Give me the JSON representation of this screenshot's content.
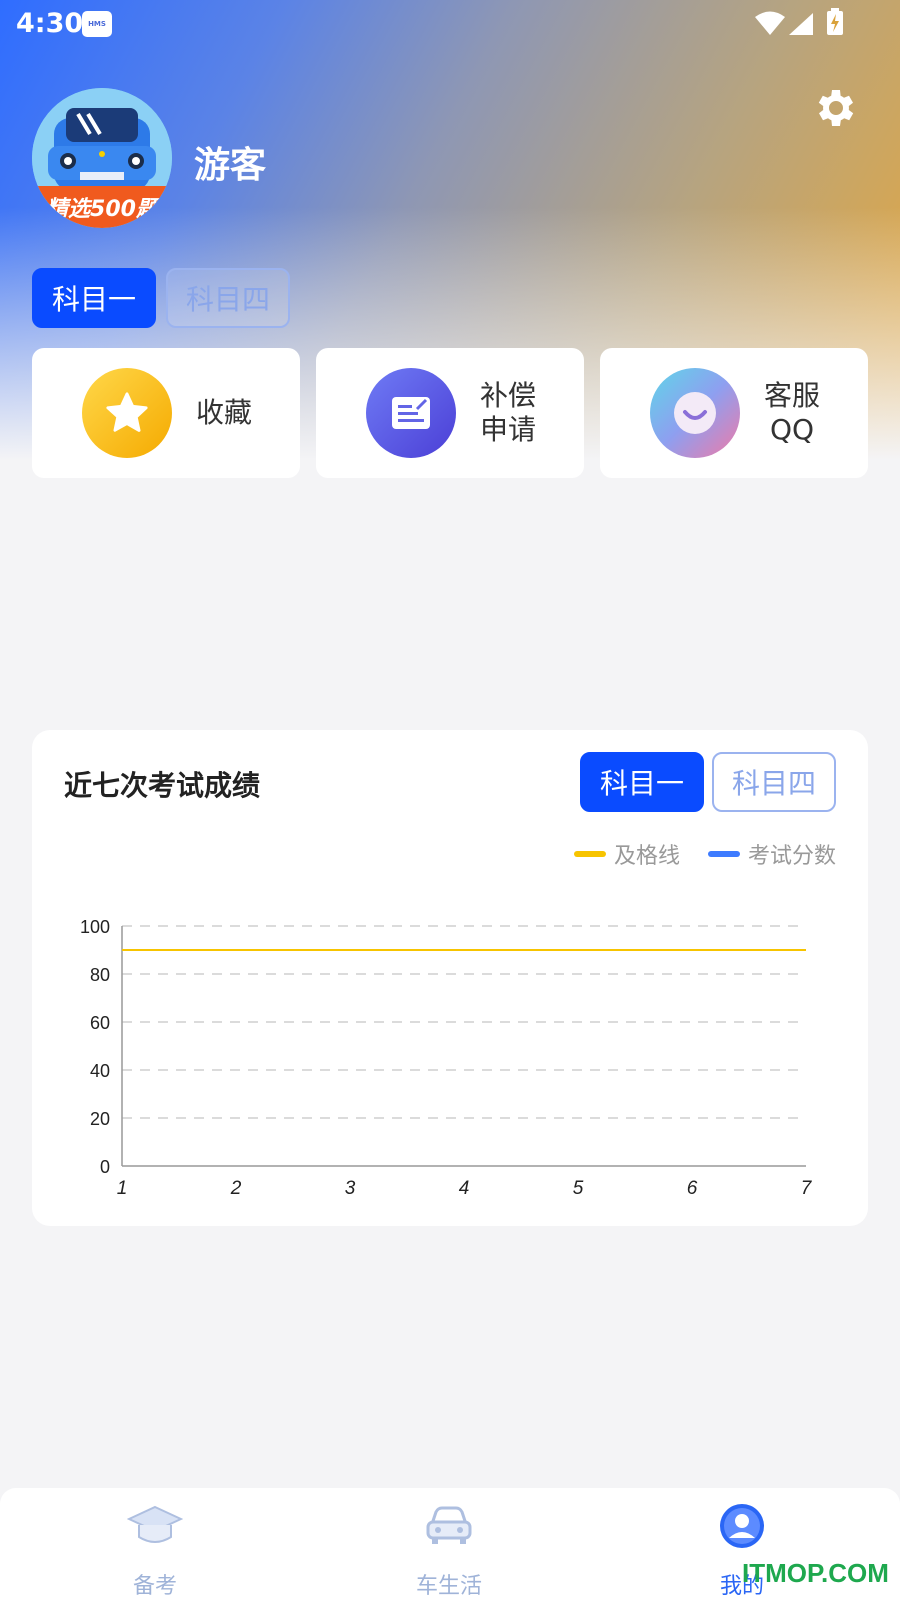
{
  "status_bar": {
    "time": "4:30",
    "badge": "HMS"
  },
  "profile": {
    "username": "游客",
    "avatar_banner": "精选500题"
  },
  "subject_tabs": {
    "tab1": "科目一",
    "tab2": "科目四"
  },
  "quick_actions": [
    {
      "label_line1": "收藏",
      "label_line2": "",
      "icon": "star-icon",
      "color": "#f7b500"
    },
    {
      "label_line1": "补偿",
      "label_line2": "申请",
      "icon": "form-icon",
      "color": "#5b5ce6"
    },
    {
      "label_line1": "客服",
      "label_line2": "QQ",
      "icon": "chat-smile-icon",
      "color": "#e77fb8"
    }
  ],
  "scores": {
    "title": "近七次考试成绩",
    "tab1": "科目一",
    "tab2": "科目四",
    "legend_pass": "及格线",
    "legend_score": "考试分数"
  },
  "chart_data": {
    "type": "line",
    "x": [
      1,
      2,
      3,
      4,
      5,
      6,
      7
    ],
    "y_ticks": [
      0,
      20,
      40,
      60,
      80,
      100
    ],
    "ylim": [
      0,
      100
    ],
    "grid": true,
    "legend_position": "top-right",
    "series": [
      {
        "name": "及格线",
        "values": [
          90,
          90,
          90,
          90,
          90,
          90,
          90
        ],
        "color": "#f7c400"
      },
      {
        "name": "考试分数",
        "values": [],
        "color": "#3d7bff"
      }
    ]
  },
  "tabbar": [
    {
      "label": "备考",
      "icon": "graduation-cap-icon"
    },
    {
      "label": "车生活",
      "icon": "car-icon"
    },
    {
      "label": "我的",
      "icon": "user-profile-icon"
    }
  ],
  "watermark": "ITMOP.COM",
  "colors": {
    "primary": "#0a4bff",
    "pass_line": "#f7c400",
    "score_line": "#3d7bff"
  }
}
